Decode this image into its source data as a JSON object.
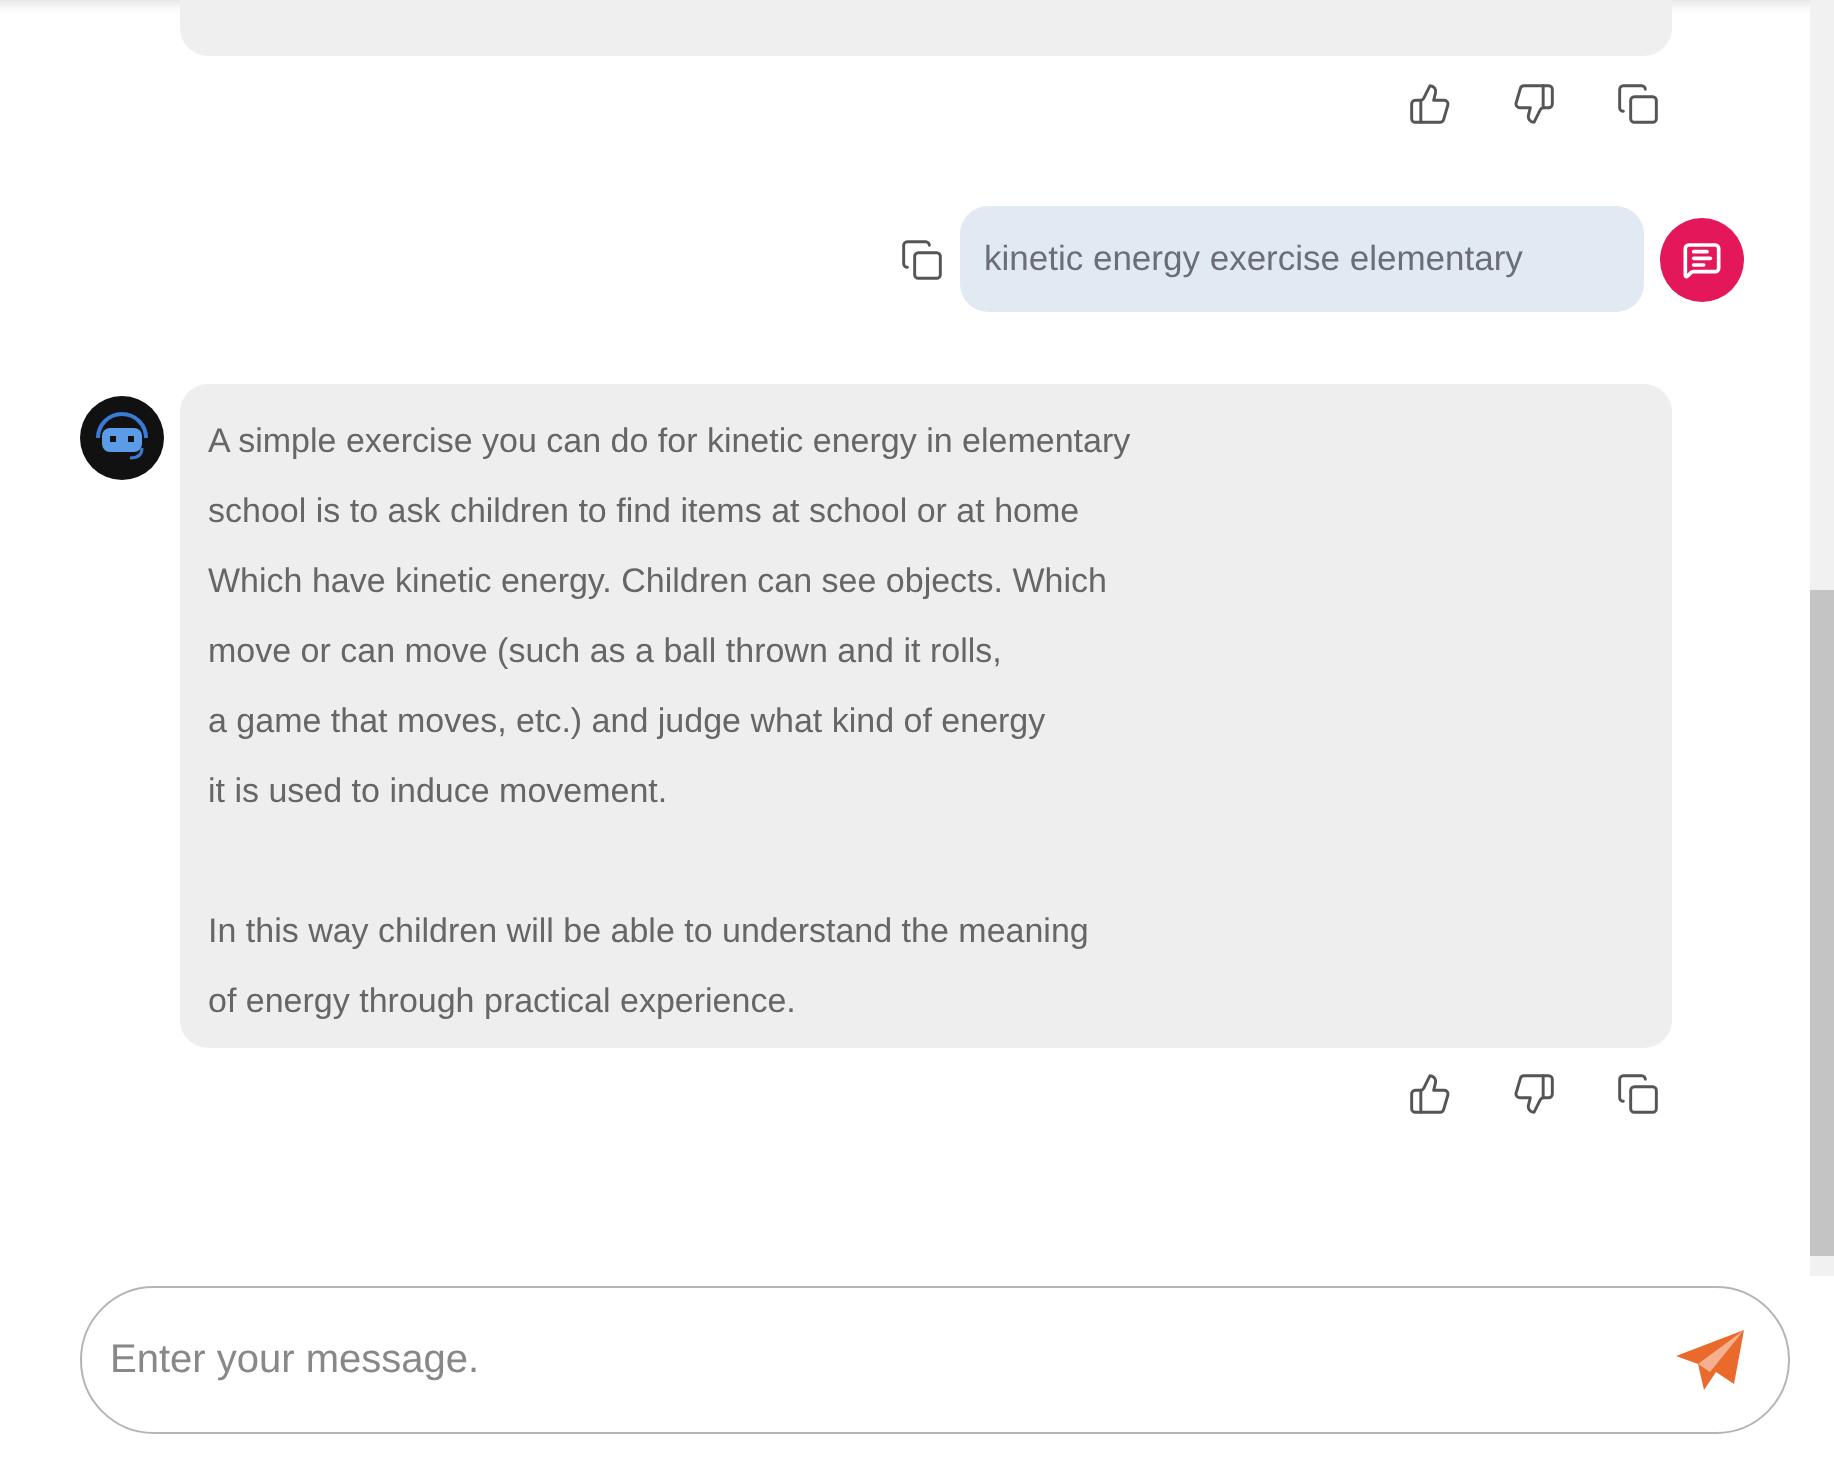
{
  "messages": [
    {
      "kind": "partial"
    },
    {
      "kind": "user",
      "text": "kinetic energy exercise elementary"
    },
    {
      "kind": "bot",
      "paragraphs": [
        [
          "A simple exercise you can do for kinetic energy in elementary",
          "school is to ask children to find items at school or at home",
          "Which have kinetic energy. Children can see objects. Which",
          "move or can move (such as a ball thrown and it rolls,",
          "a game that moves, etc.) and judge what kind of energy",
          "it is used to induce movement."
        ],
        [
          "In this way children will be able to understand the meaning",
          "of energy through practical experience."
        ]
      ]
    }
  ],
  "input": {
    "placeholder": "Enter your message."
  }
}
